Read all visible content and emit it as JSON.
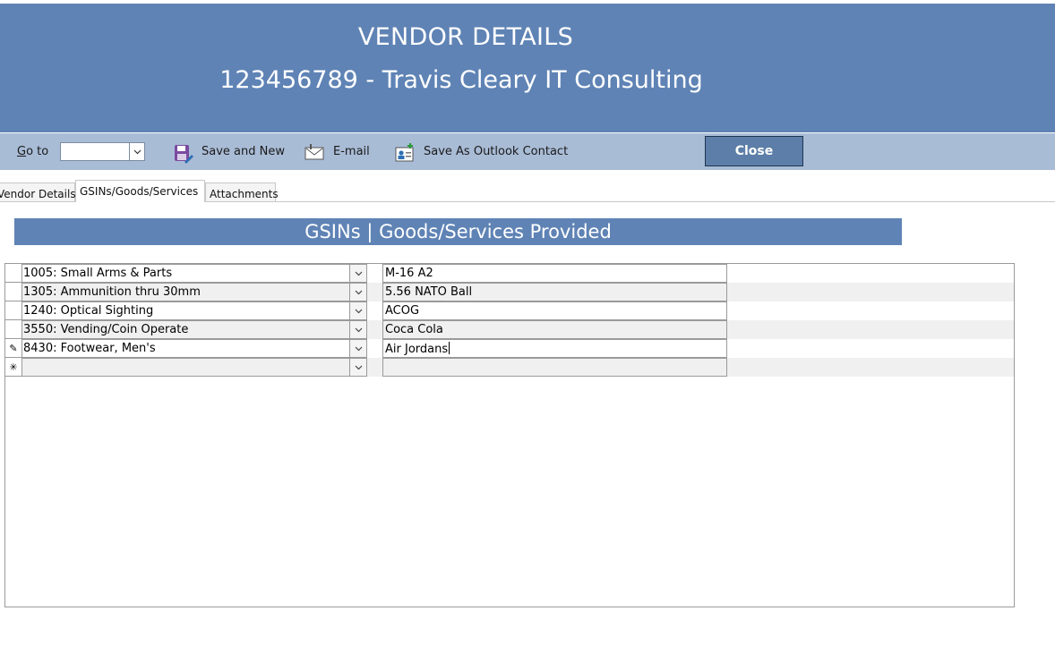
{
  "header": {
    "title": "VENDOR DETAILS",
    "subtitle": "123456789 - Travis Cleary IT Consulting"
  },
  "toolbar": {
    "goto_label": "Go to",
    "goto_value": "",
    "save_new_label": "Save and New",
    "email_label": "E-mail",
    "outlook_label": "Save As Outlook Contact",
    "close_label": "Close"
  },
  "tabs": [
    {
      "label": "Vendor Details"
    },
    {
      "label": "GSINs/Goods/Services",
      "active": true
    },
    {
      "label": "Attachments"
    }
  ],
  "section_title": "GSINs | Goods/Services Provided",
  "rows": [
    {
      "gsin": "1005: Small Arms & Parts",
      "item": "M-16 A2",
      "selector": ""
    },
    {
      "gsin": "1305: Ammunition thru 30mm",
      "item": "5.56 NATO Ball",
      "selector": ""
    },
    {
      "gsin": "1240: Optical Sighting",
      "item": "ACOG",
      "selector": ""
    },
    {
      "gsin": "3550: Vending/Coin Operate",
      "item": "Coca Cola",
      "selector": ""
    },
    {
      "gsin": "8430: Footwear, Men's",
      "item": "Air Jordans",
      "selector": "✎"
    },
    {
      "gsin": "",
      "item": "",
      "selector": "✳"
    }
  ],
  "colors": {
    "accent": "#5f83b5",
    "toolbar": "#a9bcd6",
    "close_button": "#5c7ea8"
  }
}
